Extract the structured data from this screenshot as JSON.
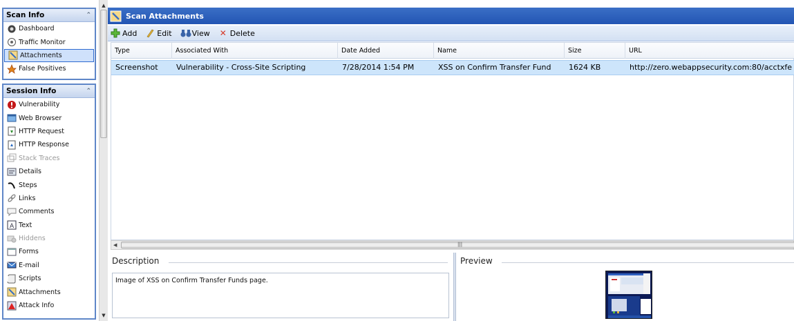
{
  "nav": {
    "scan_info": {
      "title": "Scan Info",
      "items": [
        {
          "label": "Dashboard",
          "icon": "dashboard-icon"
        },
        {
          "label": "Traffic Monitor",
          "icon": "traffic-monitor-icon"
        },
        {
          "label": "Attachments",
          "icon": "attachments-icon",
          "selected": true
        },
        {
          "label": "False Positives",
          "icon": "false-positives-icon"
        }
      ]
    },
    "session_info": {
      "title": "Session Info",
      "items": [
        {
          "label": "Vulnerability",
          "icon": "vulnerability-icon"
        },
        {
          "label": "Web Browser",
          "icon": "web-browser-icon"
        },
        {
          "label": "HTTP Request",
          "icon": "http-request-icon"
        },
        {
          "label": "HTTP Response",
          "icon": "http-response-icon"
        },
        {
          "label": "Stack Traces",
          "icon": "stack-traces-icon",
          "disabled": true
        },
        {
          "label": "Details",
          "icon": "details-icon"
        },
        {
          "label": "Steps",
          "icon": "steps-icon"
        },
        {
          "label": "Links",
          "icon": "links-icon"
        },
        {
          "label": "Comments",
          "icon": "comments-icon"
        },
        {
          "label": "Text",
          "icon": "text-icon"
        },
        {
          "label": "Hiddens",
          "icon": "hiddens-icon",
          "disabled": true
        },
        {
          "label": "Forms",
          "icon": "forms-icon"
        },
        {
          "label": "E-mail",
          "icon": "email-icon"
        },
        {
          "label": "Scripts",
          "icon": "scripts-icon"
        },
        {
          "label": "Attachments",
          "icon": "attachments-icon"
        },
        {
          "label": "Attack Info",
          "icon": "attack-info-icon"
        }
      ]
    }
  },
  "panel": {
    "title": "Scan Attachments"
  },
  "toolbar": {
    "add_label": "Add",
    "edit_label": "Edit",
    "view_label": "View",
    "delete_label": "Delete"
  },
  "table": {
    "columns": [
      "Type",
      "Associated With",
      "Date Added",
      "Name",
      "Size",
      "URL"
    ],
    "rows": [
      {
        "type": "Screenshot",
        "associated_with": "Vulnerability - Cross-Site Scripting",
        "date_added": "7/28/2014 1:54 PM",
        "name": "XSS on Confirm Transfer Fund",
        "size": "1624 KB",
        "url": "http://zero.webappsecurity.com:80/acctxfe"
      }
    ]
  },
  "description": {
    "title": "Description",
    "text": "Image of XSS on Confirm Transfer Funds page."
  },
  "preview": {
    "title": "Preview"
  },
  "colors": {
    "titlebar": "#2d5fbe",
    "selected_row": "#cde5fb",
    "nav_border": "#5e86c8"
  }
}
